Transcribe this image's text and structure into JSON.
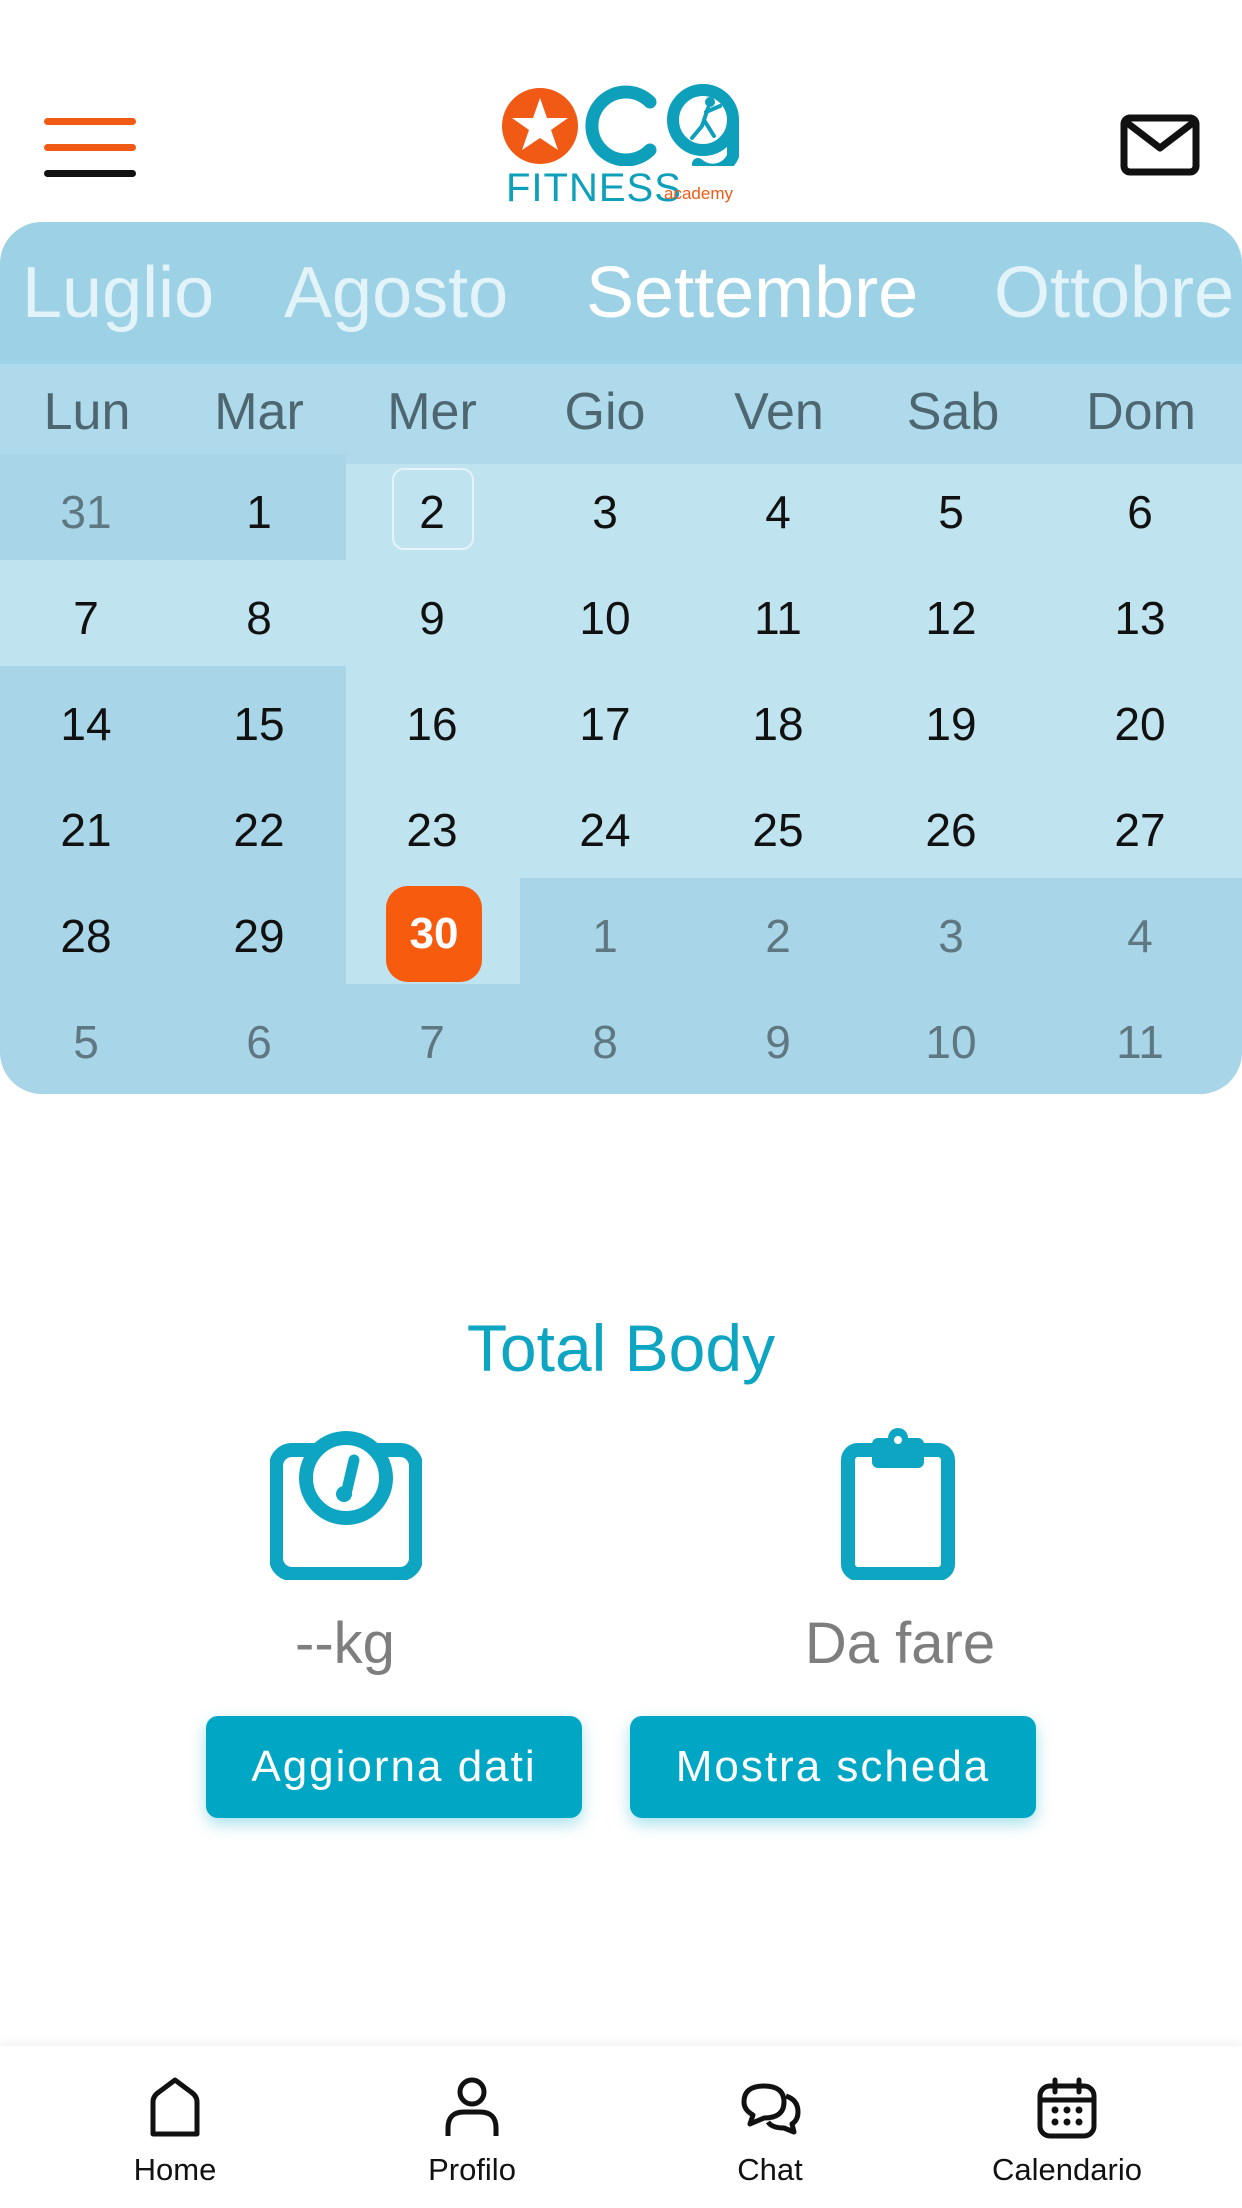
{
  "header": {
    "logo_text": "acg",
    "logo_sub": "FITNESS",
    "logo_tag": "academy"
  },
  "calendar": {
    "months": [
      "Luglio",
      "Agosto",
      "Settembre",
      "Ottobre"
    ],
    "active_month": "Settembre",
    "weekdays": [
      "Lun",
      "Mar",
      "Mer",
      "Gio",
      "Ven",
      "Sab",
      "Dom"
    ],
    "weeks": [
      [
        "31",
        "1",
        "2",
        "3",
        "4",
        "5",
        "6"
      ],
      [
        "7",
        "8",
        "9",
        "10",
        "11",
        "12",
        "13"
      ],
      [
        "14",
        "15",
        "16",
        "17",
        "18",
        "19",
        "20"
      ],
      [
        "21",
        "22",
        "23",
        "24",
        "25",
        "26",
        "27"
      ],
      [
        "28",
        "29",
        "30",
        "1",
        "2",
        "3",
        "4"
      ],
      [
        "5",
        "6",
        "7",
        "8",
        "9",
        "10",
        "11"
      ]
    ],
    "today": "30"
  },
  "workout": {
    "title": "Total Body",
    "weight_value": "--kg",
    "status_value": "Da fare",
    "update_button": "Aggiorna dati",
    "show_button": "Mostra scheda"
  },
  "nav": {
    "home": "Home",
    "profile": "Profilo",
    "chat": "Chat",
    "calendar": "Calendario"
  },
  "colors": {
    "brand_orange": "#f75b0e",
    "brand_teal": "#00a7c4",
    "calendar_bg": "#bfe3ef"
  }
}
